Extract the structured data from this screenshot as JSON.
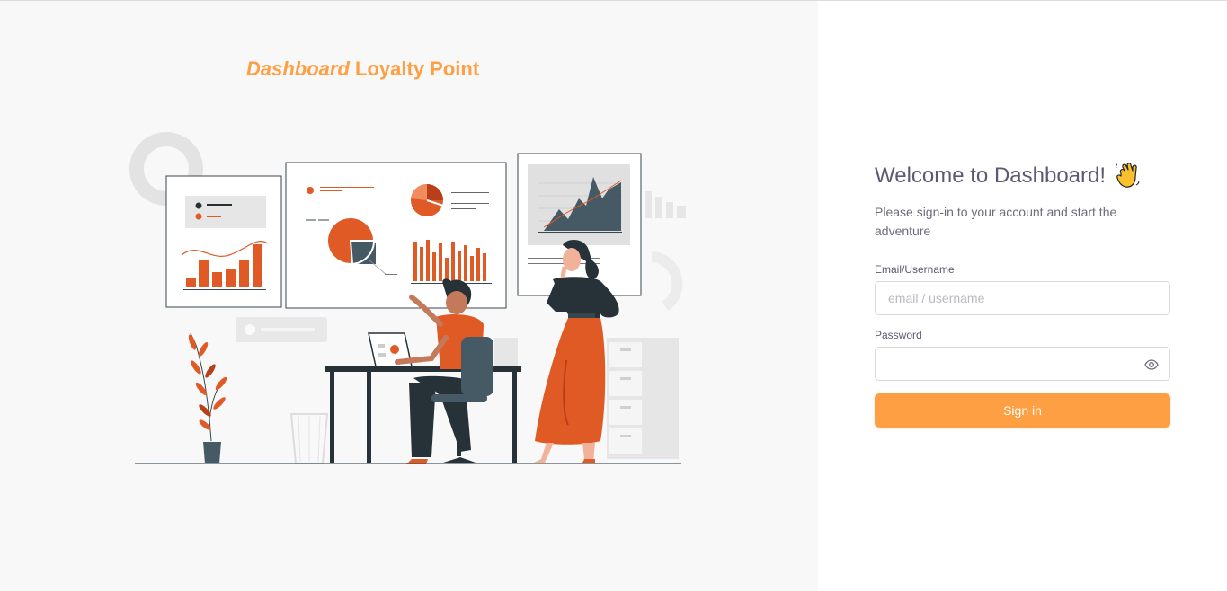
{
  "brand": {
    "title_italic": "Dashboard",
    "title_rest": "Loyalty Point",
    "color": "#ff9f43"
  },
  "login": {
    "title": "Welcome to Dashboard!",
    "title_icon": "waving-hand-icon",
    "subtitle": "Please sign-in to your account and start the adventure",
    "email_label": "Email/Username",
    "email_placeholder": "email / username",
    "password_label": "Password",
    "password_placeholder": "············",
    "password_toggle_icon": "eye-icon",
    "submit_label": "Sign in"
  },
  "colors": {
    "accent": "#ff9f43",
    "illustration_primary": "#e05a26",
    "illustration_dark": "#37474f",
    "text_heading": "#5e5873",
    "text_body": "#6e6b7b"
  }
}
